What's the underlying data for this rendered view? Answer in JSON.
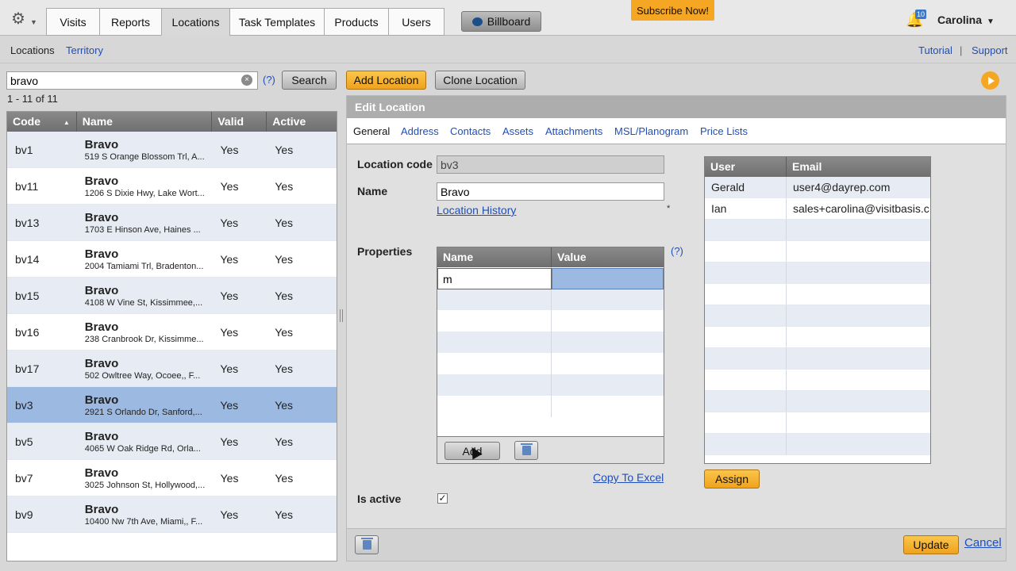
{
  "topbar": {
    "tabs": [
      "Visits",
      "Reports",
      "Locations",
      "Task Templates",
      "Products",
      "Users"
    ],
    "active_tab": "Locations",
    "billboard_label": "Billboard",
    "subscribe_label": "Subscribe Now!",
    "notification_count": "10",
    "user_name": "Carolina"
  },
  "subnav": {
    "locations": "Locations",
    "territory": "Territory",
    "tutorial": "Tutorial",
    "separator": "|",
    "support": "Support"
  },
  "search": {
    "value": "bravo",
    "clear": "×",
    "help": "(?)",
    "button_label": "Search",
    "result_count": "1 - 11 of 11"
  },
  "locations_grid": {
    "columns": [
      "Code",
      "Name",
      "Valid",
      "Active"
    ],
    "rows": [
      {
        "code": "bv1",
        "name": "Bravo",
        "address": "519 S Orange Blossom Trl, A...",
        "valid": "Yes",
        "active": "Yes"
      },
      {
        "code": "bv11",
        "name": "Bravo",
        "address": "1206 S Dixie Hwy, Lake Wort...",
        "valid": "Yes",
        "active": "Yes"
      },
      {
        "code": "bv13",
        "name": "Bravo",
        "address": "1703 E Hinson Ave, Haines ...",
        "valid": "Yes",
        "active": "Yes"
      },
      {
        "code": "bv14",
        "name": "Bravo",
        "address": "2004 Tamiami Trl, Bradenton...",
        "valid": "Yes",
        "active": "Yes"
      },
      {
        "code": "bv15",
        "name": "Bravo",
        "address": "4108 W Vine St, Kissimmee,...",
        "valid": "Yes",
        "active": "Yes"
      },
      {
        "code": "bv16",
        "name": "Bravo",
        "address": "238 Cranbrook Dr, Kissimme...",
        "valid": "Yes",
        "active": "Yes"
      },
      {
        "code": "bv17",
        "name": "Bravo",
        "address": "502 Owltree Way, Ocoee,, F...",
        "valid": "Yes",
        "active": "Yes"
      },
      {
        "code": "bv3",
        "name": "Bravo",
        "address": "2921 S Orlando Dr, Sanford,...",
        "valid": "Yes",
        "active": "Yes"
      },
      {
        "code": "bv5",
        "name": "Bravo",
        "address": "4065 W Oak Ridge Rd, Orla...",
        "valid": "Yes",
        "active": "Yes"
      },
      {
        "code": "bv7",
        "name": "Bravo",
        "address": "3025 Johnson St, Hollywood,...",
        "valid": "Yes",
        "active": "Yes"
      },
      {
        "code": "bv9",
        "name": "Bravo",
        "address": "10400 Nw 7th Ave, Miami,, F...",
        "valid": "Yes",
        "active": "Yes"
      }
    ],
    "selected_code": "bv3"
  },
  "actions": {
    "add_location": "Add Location",
    "clone_location": "Clone Location"
  },
  "edit": {
    "header": "Edit Location",
    "tabs": [
      "General",
      "Address",
      "Contacts",
      "Assets",
      "Attachments",
      "MSL/Planogram",
      "Price Lists"
    ],
    "location_code_label": "Location code",
    "location_code_value": "bv3",
    "name_label": "Name",
    "name_value": "Bravo",
    "required_mark": "*",
    "location_history": "Location History",
    "properties_label": "Properties",
    "properties_columns": [
      "Name",
      "Value"
    ],
    "properties_edit_value": "m",
    "properties_help": "(?)",
    "add_button": "Add",
    "copy_to_excel": "Copy To Excel",
    "is_active_label": "Is active",
    "is_active_checked": "✓",
    "users_columns": [
      "User",
      "Email"
    ],
    "users": [
      {
        "user": "Gerald",
        "email": "user4@dayrep.com"
      },
      {
        "user": "Ian",
        "email": "sales+carolina@visitbasis.c"
      }
    ],
    "assign_button": "Assign",
    "update_button": "Update",
    "cancel_link": "Cancel"
  },
  "colors": {
    "accent_orange": "#f5a623",
    "selection_blue": "#9cb9e2",
    "link_blue": "#1f4eb8"
  }
}
